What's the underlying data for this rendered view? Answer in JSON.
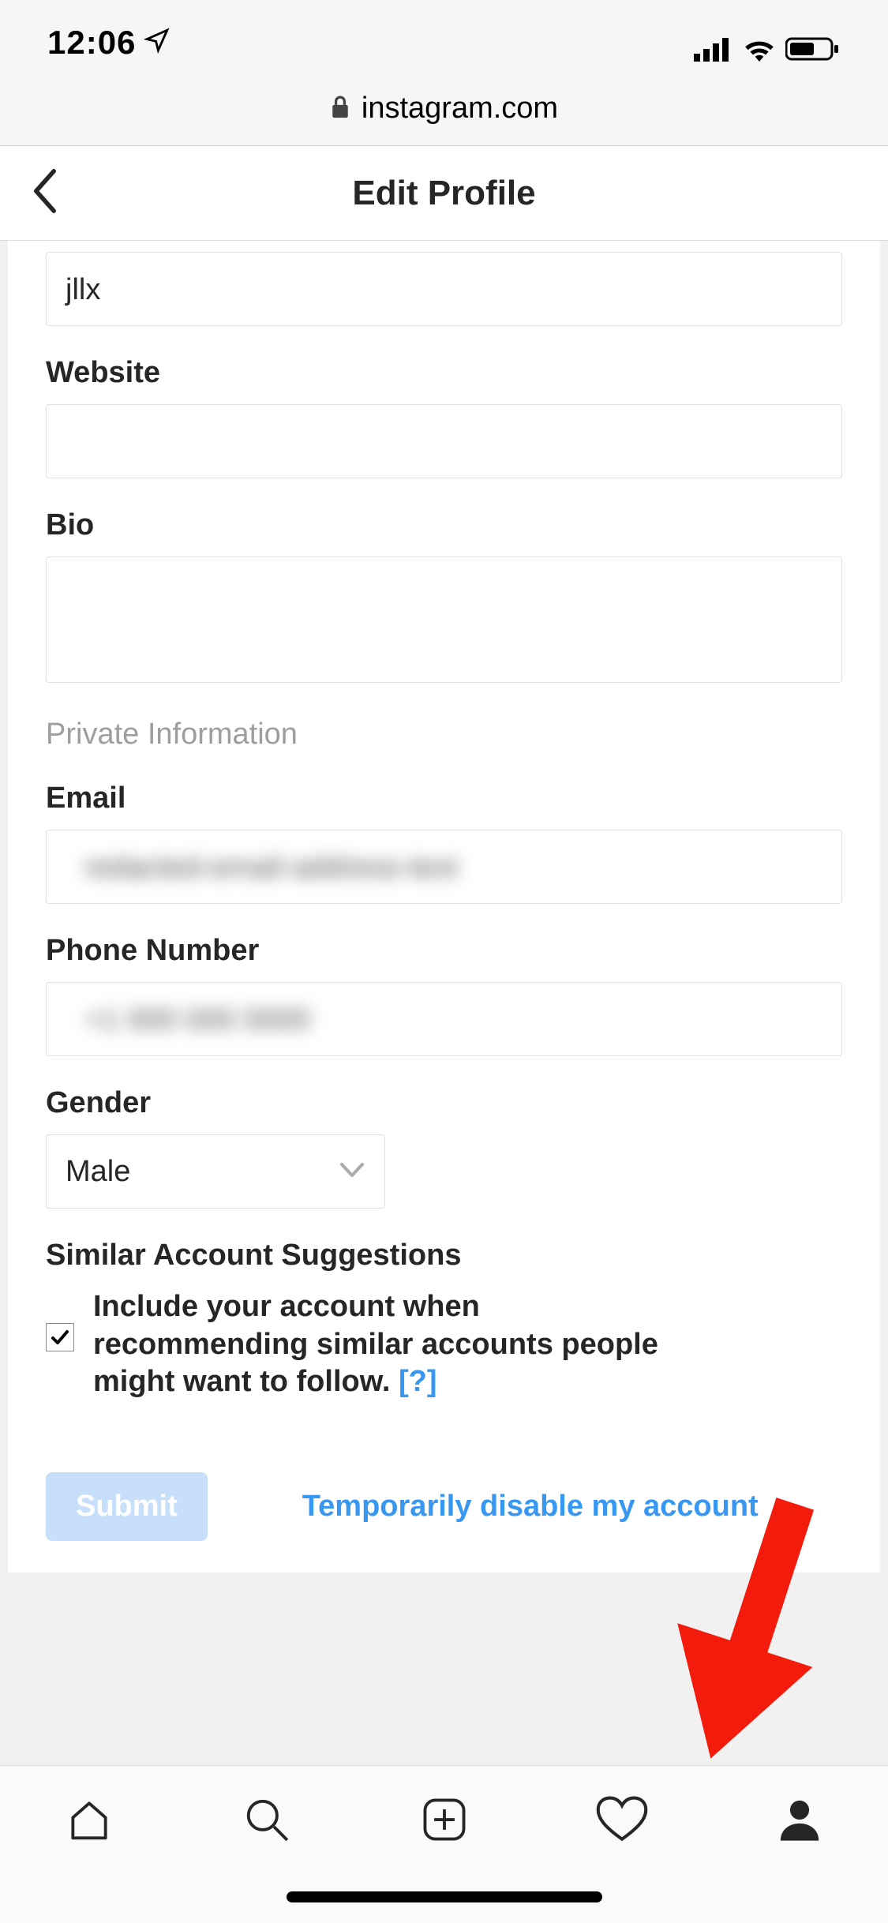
{
  "status": {
    "time": "12:06",
    "location_icon": "location-arrow-icon",
    "signal_icon": "cellular-signal-icon",
    "wifi_icon": "wifi-icon",
    "battery_icon": "battery-icon"
  },
  "browser": {
    "lock_icon": "lock-icon",
    "domain": "instagram.com"
  },
  "header": {
    "back_icon": "back-chevron-icon",
    "title": "Edit Profile"
  },
  "form": {
    "username_value": "jllx",
    "website_label": "Website",
    "website_value": "",
    "bio_label": "Bio",
    "bio_value": "",
    "private_section_label": "Private Information",
    "email_label": "Email",
    "email_value": "",
    "phone_label": "Phone Number",
    "phone_value": "",
    "gender_label": "Gender",
    "gender_value": "Male",
    "gender_chevron_icon": "chevron-down-icon",
    "suggestions_label": "Similar Account Suggestions",
    "suggestions_checked": true,
    "suggestions_text": "Include your account when recommending similar accounts people might want to follow.",
    "suggestions_help": "[?]",
    "submit_label": "Submit",
    "disable_link_label": "Temporarily disable my account"
  },
  "tabs": {
    "home_icon": "home-icon",
    "search_icon": "search-icon",
    "add_icon": "add-post-icon",
    "activity_icon": "heart-icon",
    "profile_icon": "profile-icon"
  },
  "annotation": {
    "arrow_icon": "red-arrow-icon"
  }
}
